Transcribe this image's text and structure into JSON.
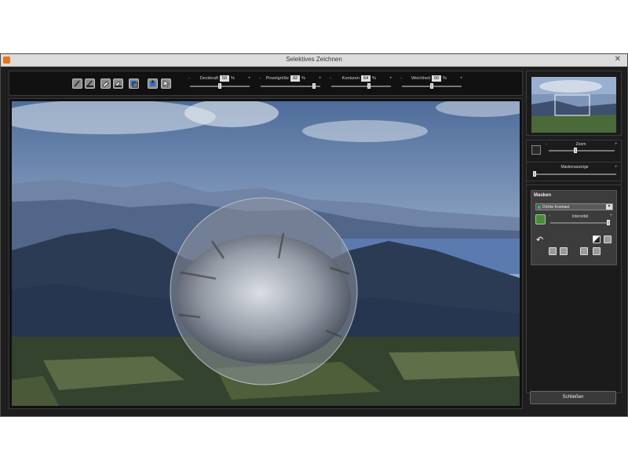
{
  "window": {
    "title": "Selektives Zeichnen",
    "close_glyph": "✕",
    "icon": "app-logo-icon",
    "accent": "#e8731c"
  },
  "toolbar": {
    "tools": [
      {
        "name": "brush-icon"
      },
      {
        "name": "brush-fill-icon"
      },
      {
        "name": "eraser-icon"
      },
      {
        "name": "eraser-fill-icon"
      },
      {
        "name": "layers-icon"
      },
      {
        "name": "stamp-icon"
      },
      {
        "name": "cursor-icon"
      }
    ],
    "params": [
      {
        "label": "Deckkraft",
        "value": "50",
        "unit": "%",
        "minus": "-",
        "plus": "+",
        "level": 0.5
      },
      {
        "label": "Pinselgröße",
        "value": "92",
        "unit": "%",
        "minus": "-",
        "plus": "+",
        "level": 0.92
      },
      {
        "label": "Konturen",
        "value": "64",
        "unit": "%",
        "minus": "-",
        "plus": "+",
        "level": 0.64
      },
      {
        "label": "Weichheit",
        "value": "50",
        "unit": "%",
        "minus": "-",
        "plus": "+",
        "level": 0.5
      }
    ]
  },
  "navigator": {
    "zoom_label": "Zoom",
    "zoom_minus": "-",
    "zoom_plus": "+",
    "zoom_level": 0.4,
    "masking_label": "Maskenanzeige",
    "masking_plus": "+",
    "masking_level": 0.0
  },
  "masks": {
    "title": "Masken",
    "selected": "Dichte Kontrast",
    "intensity_label": "Intensität",
    "intensity_minus": "-",
    "intensity_plus": "+",
    "intensity_level": 1.0
  },
  "close_button": "Schließen",
  "colors": {
    "panel": "#1b1b1b",
    "mask_active": "#22c55e"
  }
}
